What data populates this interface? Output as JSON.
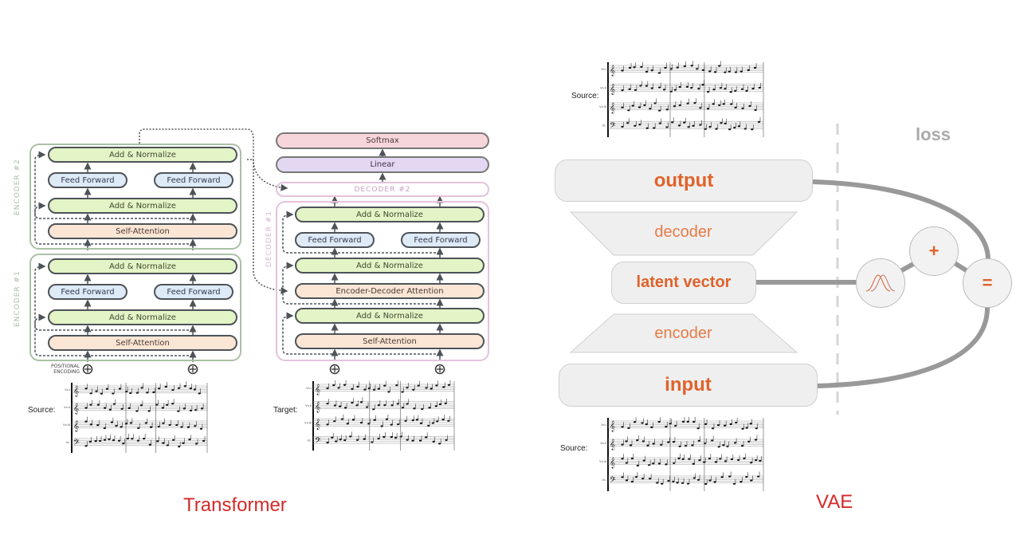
{
  "transformer": {
    "caption": "Transformer",
    "encoder2_label": "ENCODER #2",
    "encoder1_label": "ENCODER #1",
    "decoder1_label": "DECODER #1",
    "decoder2_label": "DECODER #2",
    "positional_encoding": "POSITIONAL ENCODING",
    "add_normalize": "Add & Normalize",
    "feed_forward": "Feed Forward",
    "self_attention": "Self-Attention",
    "enc_dec_attention": "Encoder-Decoder Attention",
    "linear": "Linear",
    "softmax": "Softmax",
    "source_label": "Source:",
    "target_label": "Target:"
  },
  "vae": {
    "caption": "VAE",
    "output": "output",
    "decoder": "decoder",
    "latent": "latent vector",
    "encoder": "encoder",
    "input": "input",
    "loss": "loss",
    "plus": "+",
    "equals": "=",
    "source_top_label": "Source:",
    "source_bottom_label": "Source:"
  },
  "staff_labels": [
    "Vn.I",
    "Vn.II",
    "Vn.III",
    "Vc."
  ],
  "colors": {
    "accent_orange": "#e0622a",
    "caption_red": "#d42a2a",
    "green": "#e3f4c6",
    "blue": "#dfeaf7",
    "peach": "#fbe6d6"
  }
}
